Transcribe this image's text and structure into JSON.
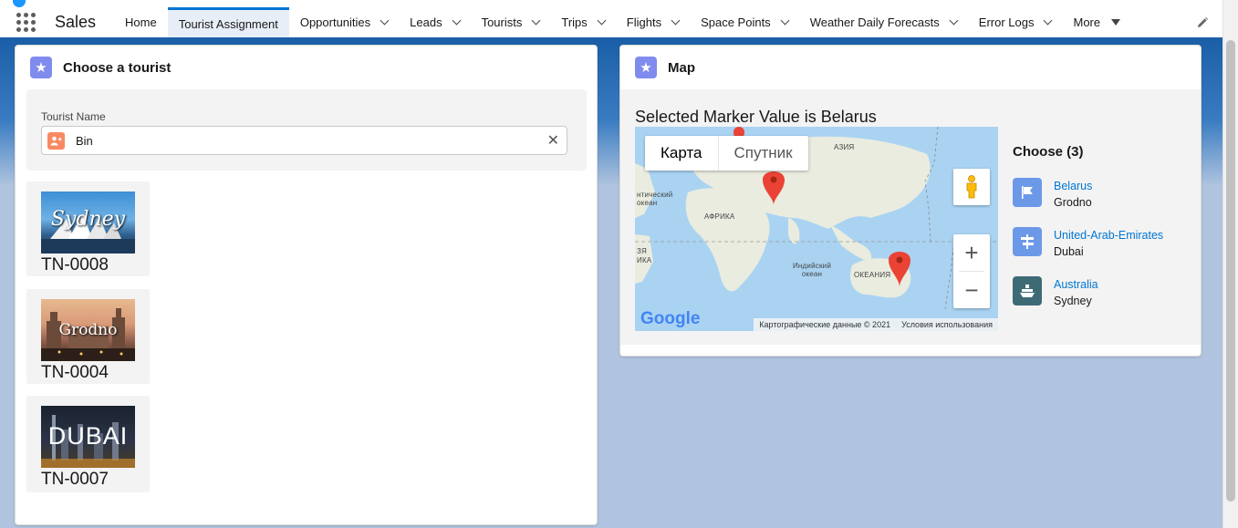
{
  "app": {
    "name": "Sales"
  },
  "nav": {
    "tabs": [
      {
        "label": "Home",
        "has_chevron": false
      },
      {
        "label": "Tourist Assignment",
        "has_chevron": false,
        "active": true
      },
      {
        "label": "Opportunities",
        "has_chevron": true
      },
      {
        "label": "Leads",
        "has_chevron": true
      },
      {
        "label": "Tourists",
        "has_chevron": true
      },
      {
        "label": "Trips",
        "has_chevron": true
      },
      {
        "label": "Flights",
        "has_chevron": true
      },
      {
        "label": "Space Points",
        "has_chevron": true
      },
      {
        "label": "Weather Daily Forecasts",
        "has_chevron": true
      },
      {
        "label": "Error Logs",
        "has_chevron": true
      }
    ],
    "more_label": "More"
  },
  "left_card": {
    "title": "Choose a tourist",
    "search": {
      "label": "Tourist Name",
      "value": "Bin"
    },
    "tiles": [
      {
        "id": "TN-0008",
        "image_text": "Sydney"
      },
      {
        "id": "TN-0004",
        "image_text": "Grodno"
      },
      {
        "id": "TN-0007",
        "image_text": "DUBAI"
      }
    ]
  },
  "right_card": {
    "title": "Map",
    "caption": "Selected Marker Value is Belarus",
    "map": {
      "type_buttons": [
        "Карта",
        "Спутник"
      ],
      "labels": {
        "asia": "АЗИЯ",
        "africa": "АФРИКА",
        "atlantic": "нтический\nокеан",
        "indian": "Индийский\nокеан",
        "oceania": "ОКЕАНИЯ",
        "left1": "ЗЯ",
        "left2": "ИКА"
      },
      "footer": {
        "data": "Картографические данные © 2021",
        "terms": "Условия использования"
      },
      "logo": "Google"
    },
    "choose_title": "Choose (3)",
    "locations": [
      {
        "name": "Belarus",
        "city": "Grodno",
        "icon": "flag-icon",
        "color": "#6c98e8"
      },
      {
        "name": "United-Arab-Emirates",
        "city": "Dubai",
        "icon": "signpost-icon",
        "color": "#6c98e8"
      },
      {
        "name": "Australia",
        "city": "Sydney",
        "icon": "ship-icon",
        "color": "#3e6a76"
      }
    ]
  },
  "colors": {
    "brand_blue": "#1b5fa8",
    "accent": "#0176d3",
    "card_icon": "#7f8ced",
    "marker_red": "#ea4335"
  }
}
